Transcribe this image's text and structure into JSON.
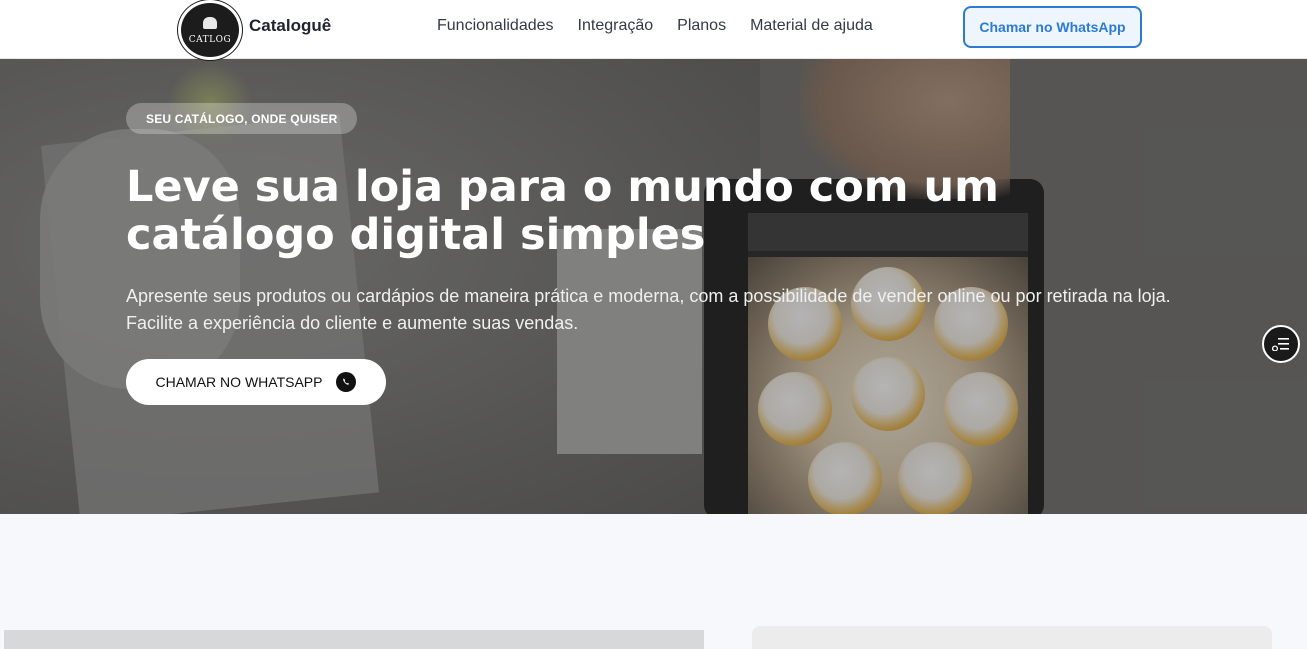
{
  "header": {
    "logo_text": "CATLOG",
    "brand": "Cataloguê",
    "nav": [
      "Funcionalidades",
      "Integração",
      "Planos",
      "Material de ajuda"
    ],
    "cta": "Chamar no WhatsApp"
  },
  "hero": {
    "badge": "SEU CATÁLOGO, ONDE QUISER",
    "headline_line1": "Leve sua loja para o mundo com um",
    "headline_line2": "catálogo digital simples",
    "subtitle_line1": "Apresente seus produtos ou cardápios de maneira prática e moderna, com a possibilidade de vender online ou por retirada na loja.",
    "subtitle_line2": "Facilite a experiência do cliente e aumente suas vendas.",
    "cta": "CHAMAR NO WHATSAPP",
    "cta_icon": "whatsapp-icon"
  },
  "floating_button": {
    "icon": "settings-menu-icon"
  },
  "colors": {
    "accent": "#2b7bd4",
    "hero_text": "#ffffff",
    "page_bg": "#f6f8fb"
  }
}
